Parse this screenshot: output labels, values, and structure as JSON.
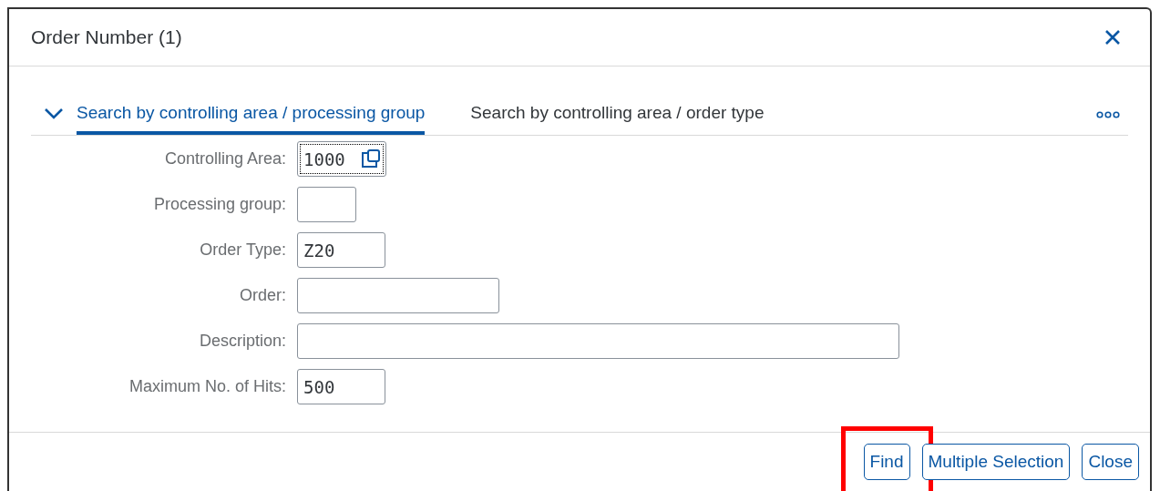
{
  "dialog": {
    "title": "Order Number (1)"
  },
  "tabs": [
    {
      "label": "Search by controlling area / processing group",
      "selected": true
    },
    {
      "label": "Search by controlling area / order type",
      "selected": false
    }
  ],
  "fields": [
    {
      "label": "Controlling Area:",
      "value": "1000",
      "focused": true,
      "value_help": true
    },
    {
      "label": "Processing group:",
      "focused": false,
      "value_help": false
    },
    {
      "label": "Order Type:",
      "value": "Z20",
      "focused": false,
      "value_help": false
    },
    {
      "label": "Order:",
      "focused": false,
      "value_help": false
    },
    {
      "label": "Description:",
      "focused": false,
      "value_help": false
    },
    {
      "label": "Maximum No. of Hits:",
      "value": "500",
      "focused": false,
      "value_help": false
    }
  ],
  "buttons": [
    {
      "label": "Find",
      "highlighted": true
    },
    {
      "label": "Multiple Selection",
      "highlighted": false
    },
    {
      "label": "Close",
      "highlighted": false
    }
  ]
}
